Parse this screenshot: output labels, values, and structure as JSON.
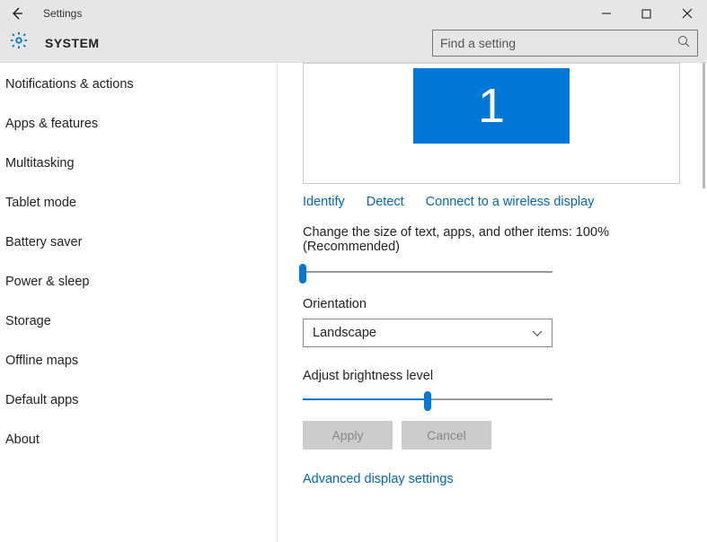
{
  "window": {
    "title": "Settings"
  },
  "header": {
    "title": "SYSTEM",
    "search_placeholder": "Find a setting"
  },
  "sidebar": {
    "items": [
      {
        "label": "Notifications & actions"
      },
      {
        "label": "Apps & features"
      },
      {
        "label": "Multitasking"
      },
      {
        "label": "Tablet mode"
      },
      {
        "label": "Battery saver"
      },
      {
        "label": "Power & sleep"
      },
      {
        "label": "Storage"
      },
      {
        "label": "Offline maps"
      },
      {
        "label": "Default apps"
      },
      {
        "label": "About"
      }
    ]
  },
  "display": {
    "monitor_number": "1",
    "links": {
      "identify": "Identify",
      "detect": "Detect",
      "connect_wireless": "Connect to a wireless display"
    },
    "scale_label": "Change the size of text, apps, and other items: 100% (Recommended)",
    "scale_slider_percent": 0,
    "orientation_label": "Orientation",
    "orientation_value": "Landscape",
    "brightness_label": "Adjust brightness level",
    "brightness_slider_percent": 50,
    "apply_label": "Apply",
    "cancel_label": "Cancel",
    "advanced_link": "Advanced display settings"
  }
}
